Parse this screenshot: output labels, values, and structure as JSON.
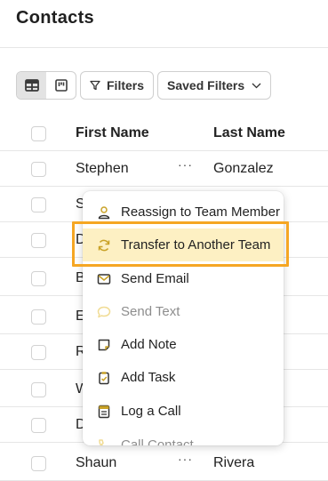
{
  "header": {
    "title": "Contacts"
  },
  "toolbar": {
    "filters_label": "Filters",
    "saved_filters_label": "Saved Filters"
  },
  "table": {
    "columns": {
      "first_name": "First Name",
      "last_name": "Last Name"
    },
    "row_menu_label": "···",
    "rows": [
      {
        "first": "Stephen",
        "last": "Gonzalez"
      },
      {
        "first": "S",
        "last": ""
      },
      {
        "first": "D",
        "last": ""
      },
      {
        "first": "B",
        "last": ""
      },
      {
        "first": "E",
        "last": ""
      },
      {
        "first": "R",
        "last": ""
      },
      {
        "first": "W",
        "last": ""
      },
      {
        "first": "D",
        "last": ""
      },
      {
        "first": "Shaun",
        "last": "Rivera"
      }
    ]
  },
  "context_menu": {
    "items": [
      {
        "label": "Reassign to Team Member",
        "icon": "person-icon"
      },
      {
        "label": "Transfer to Another Team",
        "icon": "transfer-icon",
        "highlighted": true
      },
      {
        "label": "Send Email",
        "icon": "envelope-icon"
      },
      {
        "label": "Send Text",
        "icon": "chat-bubble-icon",
        "disabled": true
      },
      {
        "label": "Add Note",
        "icon": "note-icon"
      },
      {
        "label": "Add Task",
        "icon": "clipboard-icon"
      },
      {
        "label": "Log a Call",
        "icon": "call-log-icon"
      },
      {
        "label": "Call Contact",
        "icon": "phone-icon",
        "disabled": true
      }
    ]
  },
  "colors": {
    "highlight_fill": "#fdf0c3",
    "highlight_border": "#f5a623",
    "icon_accent": "#c9a227"
  }
}
